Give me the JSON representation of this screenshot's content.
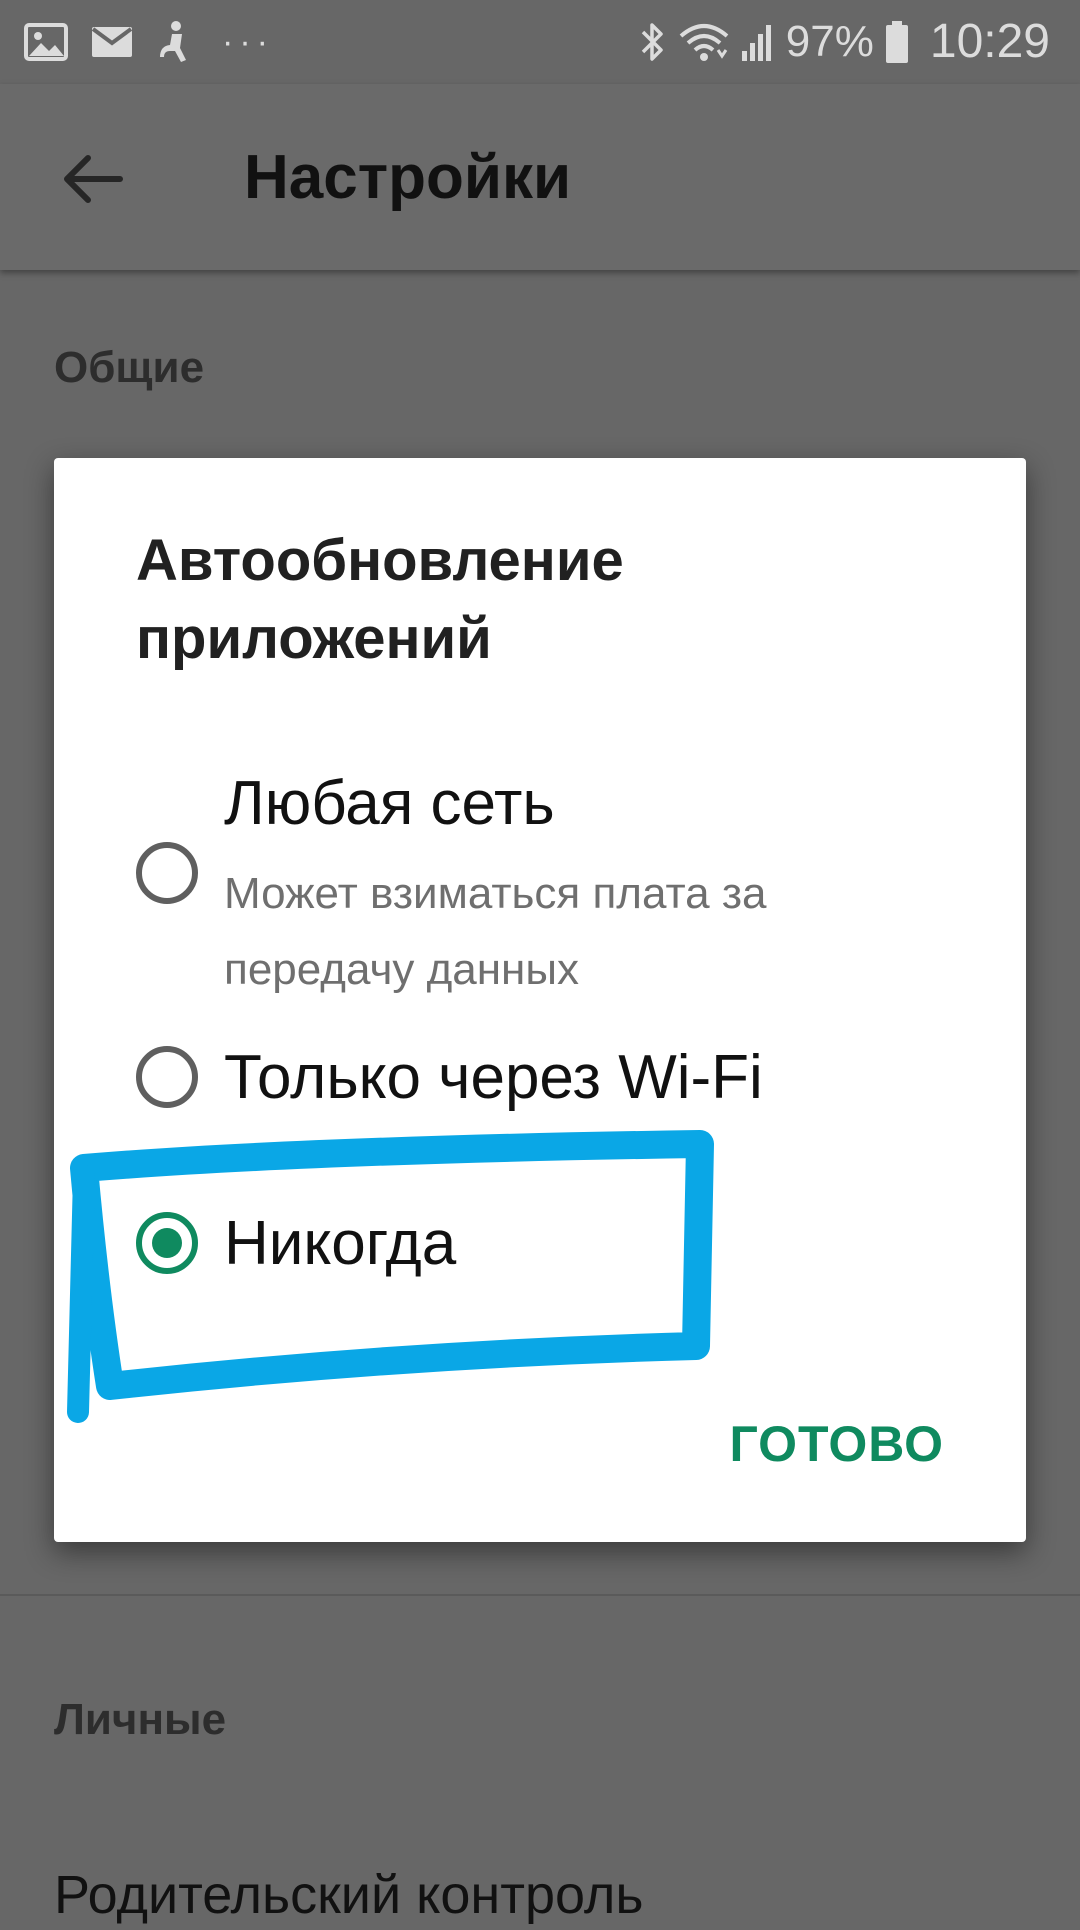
{
  "status_bar": {
    "battery": "97%",
    "time": "10:29",
    "more": "···",
    "icons": [
      "gallery-icon",
      "mail-icon",
      "accessibility-icon",
      "bluetooth-icon",
      "wifi-icon",
      "signal-icon",
      "battery-icon"
    ]
  },
  "app_bar": {
    "title": "Настройки"
  },
  "sections": {
    "general": "Общие",
    "personal": "Личные"
  },
  "list": {
    "parental_control": "Родительский контроль"
  },
  "dialog": {
    "title": "Автообновление приложений",
    "options": [
      {
        "label": "Любая сеть",
        "sublabel": "Может взиматься плата за передачу данных",
        "selected": false
      },
      {
        "label": "Только через Wi-Fi",
        "selected": false
      },
      {
        "label": "Никогда",
        "selected": true
      }
    ],
    "done_label": "ГОТОВО"
  },
  "colors": {
    "accent": "#0f8a5f",
    "scrim": "#676767",
    "highlight": "#0aa7e6"
  }
}
